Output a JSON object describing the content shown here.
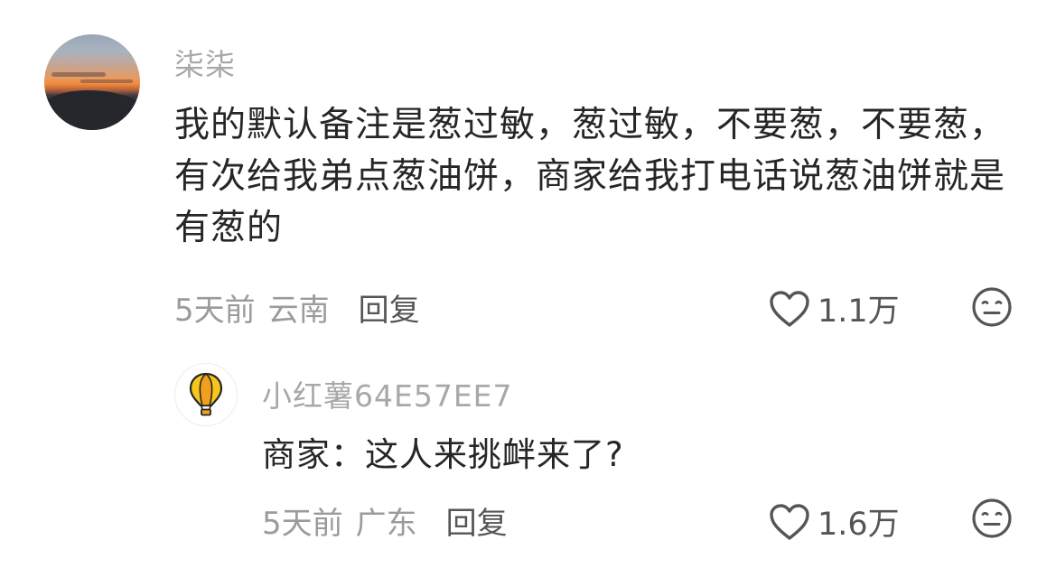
{
  "comment": {
    "username": "柒柒",
    "text": "我的默认备注是葱过敏，葱过敏，不要葱，不要葱，有次给我弟点葱油饼，商家给我打电话说葱油饼就是有葱的",
    "time": "5天前",
    "location": "云南",
    "reply_label": "回复",
    "like_count": "1.1万",
    "icons": {
      "like": "heart-outline-icon",
      "dislike": "neutral-face-icon"
    }
  },
  "reply": {
    "username": "小红薯64E57EE7",
    "text": "商家：这人来挑衅来了?",
    "time": "5天前",
    "location": "广东",
    "reply_label": "回复",
    "like_count": "1.6万",
    "avatar_icon": "hot-air-balloon-icon"
  },
  "colors": {
    "text": "#262626",
    "muted": "#9b9b9b",
    "username": "#a8a8a8",
    "balloon_yellow": "#f7c61a",
    "balloon_orange": "#f2a01b"
  }
}
